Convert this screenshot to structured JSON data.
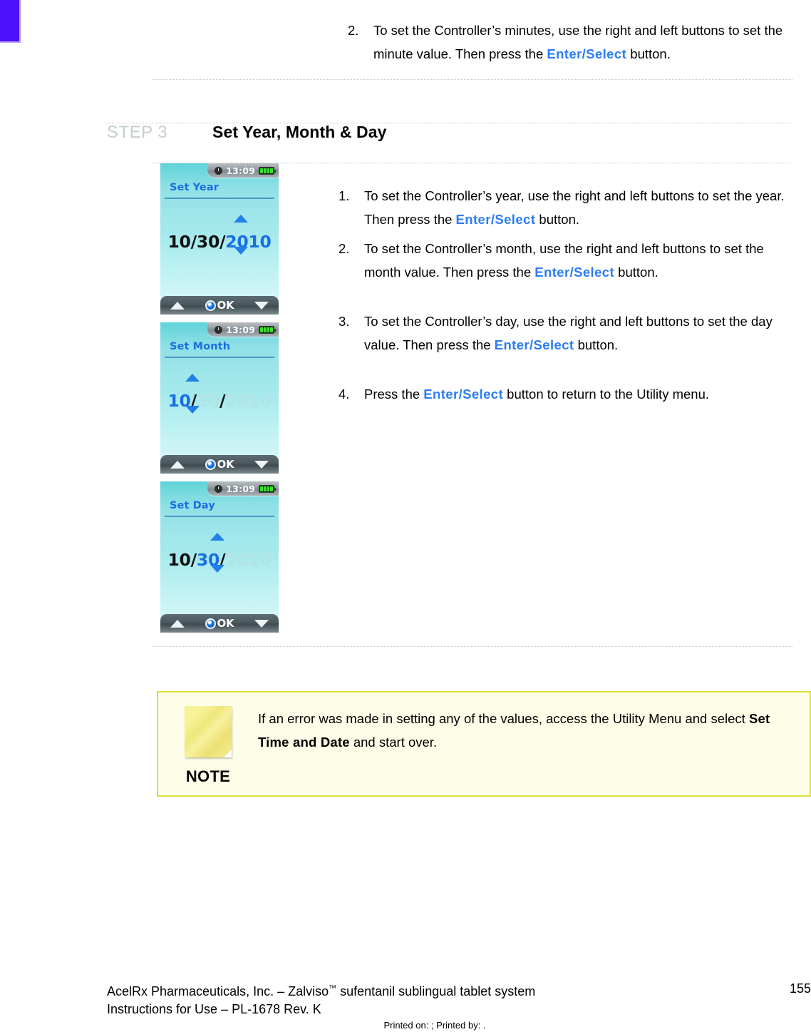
{
  "page": {
    "corner_mark_color": "#4d11fb",
    "accent_color": "#2b7cf7",
    "step_label_color": "#c3cfcb"
  },
  "top_continuation": {
    "items": [
      {
        "number": "2.",
        "text_before": "To set the Controller’s minutes, use the right and left buttons to set the minute value.  Then press the ",
        "highlight": "Enter/Select",
        "text_after": " button."
      }
    ]
  },
  "step": {
    "label": "STEP 3",
    "title": "Set Year, Month & Day"
  },
  "screens": [
    {
      "name": "set-year-screen",
      "status_time": "13:09",
      "title": "Set Year",
      "month": "10",
      "day": "30",
      "year": "2010",
      "active_field": "year",
      "softkey_ok": "OK",
      "battery_bars": 4
    },
    {
      "name": "set-month-screen",
      "status_time": "13:09",
      "title": "Set Month",
      "month": "10",
      "day": "30",
      "year": "2010",
      "active_field": "month",
      "softkey_ok": "OK",
      "battery_bars": 4
    },
    {
      "name": "set-day-screen",
      "status_time": "13:09",
      "title": "Set Day",
      "month": "10",
      "day": "30",
      "year": "2010",
      "active_field": "day",
      "softkey_ok": "OK",
      "battery_bars": 4
    }
  ],
  "instructions": [
    {
      "number": "1.",
      "text_before": "To set the Controller’s year, use the right and left buttons to set the year.  Then press the ",
      "highlight": "Enter/Select",
      "text_after": " button."
    },
    {
      "number": "2.",
      "text_before": "To set the Controller’s month, use the right and left buttons to set the month value.  Then press the ",
      "highlight": "Enter/Select",
      "text_after": " button."
    },
    {
      "number": "3.",
      "text_before": "To set the Controller’s day, use the right and left buttons to set the day value.  Then press the ",
      "highlight": "Enter/Select",
      "text_after": " button."
    },
    {
      "number": "4.",
      "text_before": "Press the ",
      "highlight": "Enter/Select",
      "text_after": " button to return to the Utility menu."
    }
  ],
  "note": {
    "word": "NOTE",
    "text_before": "If an error was made in setting any of the values, access the Utility Menu and select ",
    "strong": "Set Time and Date",
    "text_after": " and start over."
  },
  "footer": {
    "line1_a": "AcelRx Pharmaceuticals, Inc. – Zalviso",
    "line1_tm": "™",
    "line1_b": " sufentanil sublingual tablet system",
    "line2": "Instructions for Use – PL-1678 Rev. K",
    "page_number": "155",
    "printed": "Printed on: ; Printed by: ."
  }
}
